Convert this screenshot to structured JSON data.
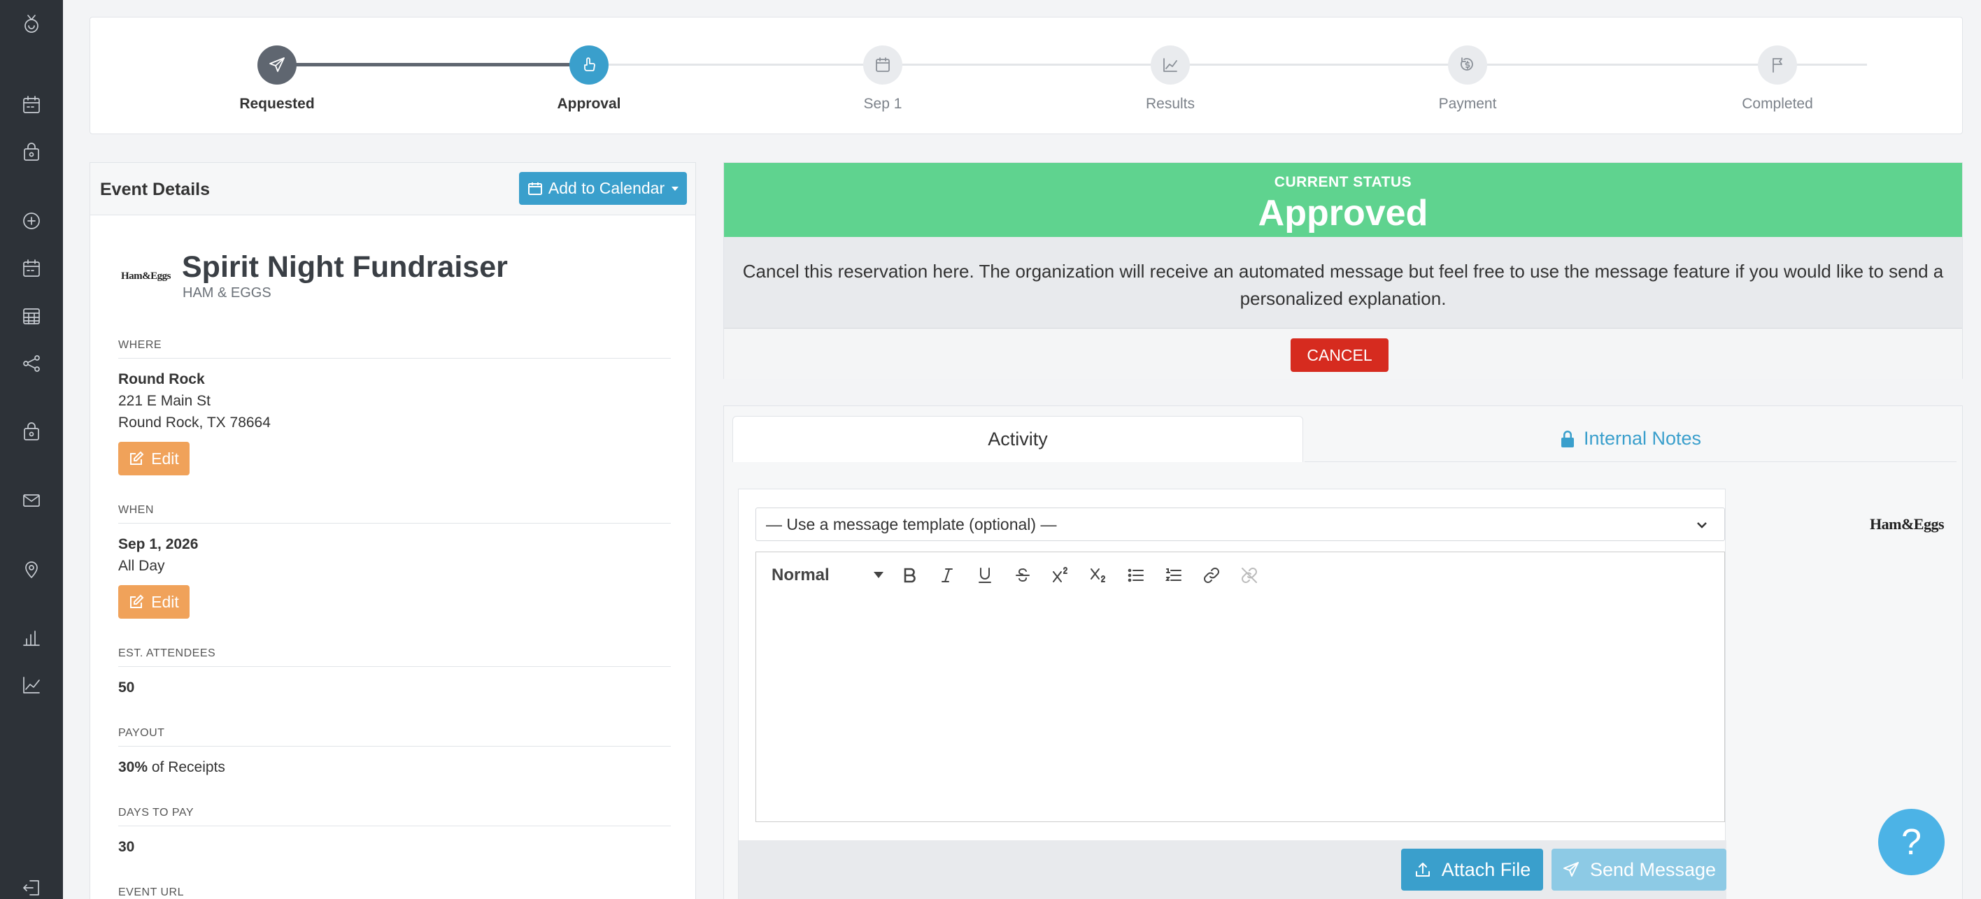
{
  "sidebar": {
    "icons": [
      "logo-icon",
      "calendar-icon",
      "bag-icon",
      "plus-circle-icon",
      "calendar-icon",
      "grid-calendar-icon",
      "share-icon",
      "bag-icon",
      "mail-icon",
      "location-icon",
      "bar-chart-icon",
      "line-chart-icon",
      "logout-icon"
    ]
  },
  "stepper": {
    "steps": [
      {
        "label": "Requested",
        "state": "done",
        "icon": "send-icon"
      },
      {
        "label": "Approval",
        "state": "active",
        "icon": "thumb-icon"
      },
      {
        "label": "Sep 1",
        "state": "pending",
        "icon": "calendar-icon"
      },
      {
        "label": "Results",
        "state": "pending",
        "icon": "chart-icon"
      },
      {
        "label": "Payment",
        "state": "pending",
        "icon": "money-icon"
      },
      {
        "label": "Completed",
        "state": "pending",
        "icon": "flag-icon"
      }
    ]
  },
  "event_details": {
    "title": "Event Details",
    "add_to_calendar": "Add to Calendar",
    "logo_text": "Ham&Eggs",
    "event_name": "Spirit Night Fundraiser",
    "org_name": "HAM & EGGS",
    "where": {
      "label": "WHERE",
      "name": "Round Rock",
      "address1": "221 E Main St",
      "address2": "Round Rock, TX 78664",
      "edit": "Edit"
    },
    "when": {
      "label": "WHEN",
      "date": "Sep 1, 2026",
      "time": "All Day",
      "edit": "Edit"
    },
    "attendees": {
      "label": "EST. ATTENDEES",
      "value": "50"
    },
    "payout": {
      "label": "PAYOUT",
      "percent": "30%",
      "suffix": " of Receipts"
    },
    "days_to_pay": {
      "label": "DAYS TO PAY",
      "value": "30"
    },
    "event_url": {
      "label": "EVENT URL"
    }
  },
  "status": {
    "small_label": "CURRENT STATUS",
    "value": "Approved",
    "message": "Cancel this reservation here. The organization will receive an automated message but feel free to use the message feature if you would like to send a personalized explanation.",
    "cancel_label": "CANCEL",
    "banner_color": "#5fd38f"
  },
  "activity": {
    "tabs": {
      "activity": "Activity",
      "internal_notes": "Internal Notes"
    },
    "template_placeholder": "— Use a message template (optional) —",
    "format_value": "Normal",
    "attach_label": "Attach File",
    "send_label": "Send Message",
    "logo_text": "Ham&Eggs"
  },
  "help": {
    "label": "?"
  }
}
